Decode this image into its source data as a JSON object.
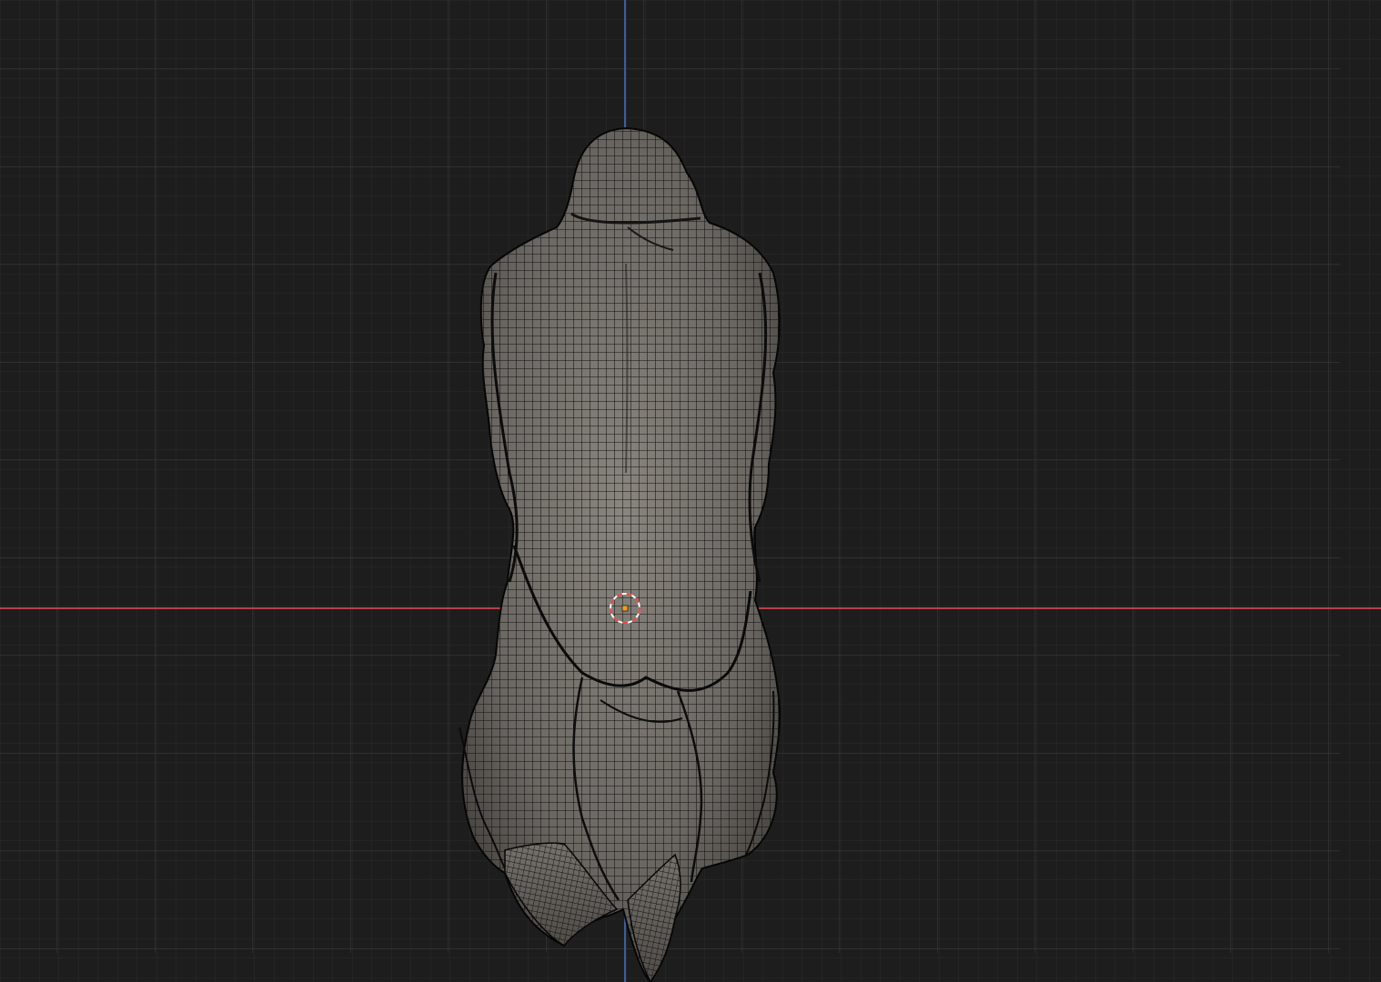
{
  "viewport": {
    "background_color": "#1d1d1d",
    "grid_minor_color": "#2b2b2b",
    "grid_major_color": "#3a3a3a",
    "axis_x_color": "#b8404a",
    "axis_z_color": "#3b5f9c"
  },
  "mesh": {
    "base_color": "#6a6661",
    "highlight_color": "#8a857f",
    "wire_color": "#111111",
    "icon": "cloaked-figure-mesh"
  },
  "cursor_3d": {
    "icon": "3d-cursor-icon",
    "ring_color": "#e04848",
    "inner_color": "#ffffff"
  }
}
